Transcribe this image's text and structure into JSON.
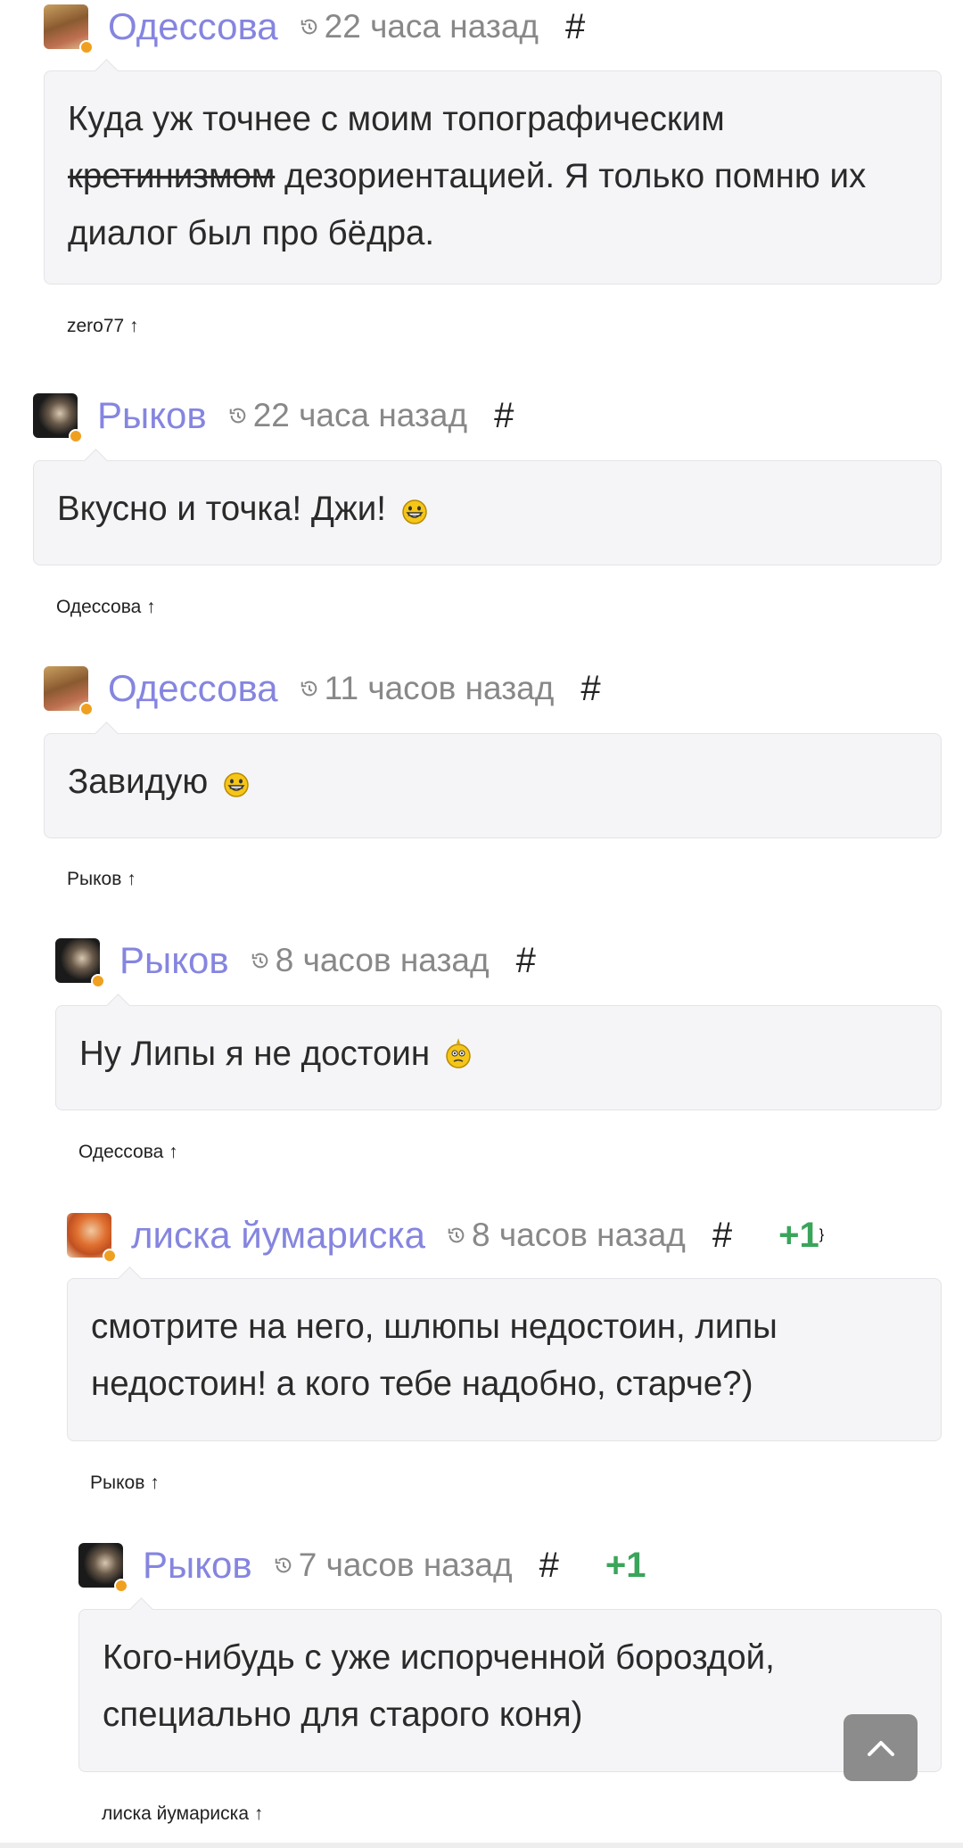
{
  "comments": [
    {
      "author": "Одессова",
      "time": "22 часа назад",
      "hash": "#",
      "votes": "",
      "text_before": "Куда уж точнее с моим топографическим",
      "text_strike": "кретинизмом",
      "text_after": " дезориентацией. Я только помню их диалог был про бёдра.",
      "reply_to": "zero77 ↑",
      "avatar_icon": "avatar-woman",
      "emoji": ""
    },
    {
      "author": "Рыков",
      "time": "22 часа назад",
      "hash": "#",
      "votes": "",
      "text": "Вкусно и точка! Джи!",
      "emoji": "grin-smiley-icon",
      "reply_to": "Одессова ↑",
      "avatar_icon": "avatar-bearded-man"
    },
    {
      "author": "Одессова",
      "time": "11 часов назад",
      "hash": "#",
      "votes": "",
      "text": "Завидую",
      "emoji": "grin-smiley-icon",
      "reply_to": "Рыков ↑",
      "avatar_icon": "avatar-woman"
    },
    {
      "author": "Рыков",
      "time": "8 часов назад",
      "hash": "#",
      "votes": "",
      "text": "Ну Липы я не достоин",
      "emoji": "shy-smiley-icon",
      "reply_to": "Одессова ↑",
      "avatar_icon": "avatar-bearded-man"
    },
    {
      "author": "лиска йумариска",
      "time": "8 часов назад",
      "hash": "#",
      "votes": "+1",
      "text": "смотрите на него, шлюпы недостоин, липы недостоин! а кого тебе надобно, старче?)",
      "emoji": "",
      "reply_to": "Рыков ↑",
      "avatar_icon": "avatar-redhead"
    },
    {
      "author": "Рыков",
      "time": "7 часов назад",
      "hash": "#",
      "votes": "+1",
      "text": "Кого-нибудь с уже испорченной бороздой, специально для старого коня)",
      "emoji": "",
      "reply_to": "лиска йумариска ↑",
      "avatar_icon": "avatar-bearded-man"
    }
  ],
  "colors": {
    "author": "#8585e0",
    "votes": "#3aa55a",
    "bubble": "#f5f5f7",
    "status_dot": "#f0a020",
    "scroll_button": "#8c8c8c"
  },
  "scroll_top_icon": "chevron-up-icon"
}
